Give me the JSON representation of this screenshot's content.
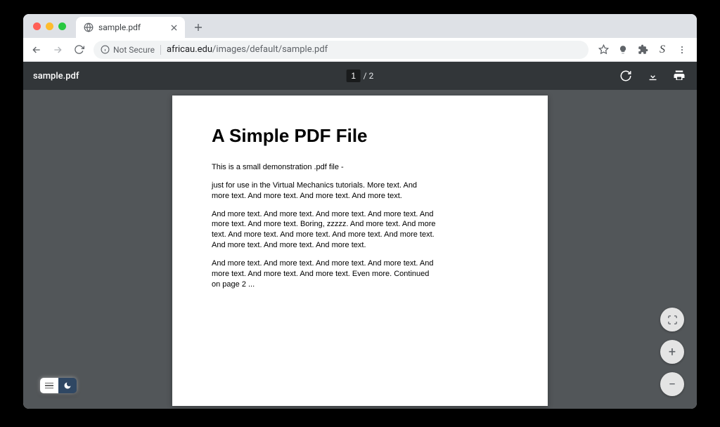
{
  "browser": {
    "tab_title": "sample.pdf",
    "security_label": "Not Secure",
    "url_host": "africau.edu",
    "url_path": "/images/default/sample.pdf"
  },
  "pdf_toolbar": {
    "title": "sample.pdf",
    "current_page": "1",
    "page_separator": "/ 2"
  },
  "document": {
    "heading": "A Simple PDF File",
    "para1": "This is a small demonstration .pdf file -",
    "para2": "just for use in the Virtual Mechanics tutorials. More text. And more text. And more text. And more text. And more text.",
    "para3": "And more text. And more text. And more text. And more text. And more text. And more text. Boring, zzzzz. And more text. And more text. And more text. And more text. And more text. And more text. And more text. And more text. And more text.",
    "para4": "And more text. And more text. And more text. And more text. And more text. And more text. And more text. Even more. Continued on page 2 ..."
  },
  "zoom": {
    "plus": "+",
    "minus": "−"
  }
}
